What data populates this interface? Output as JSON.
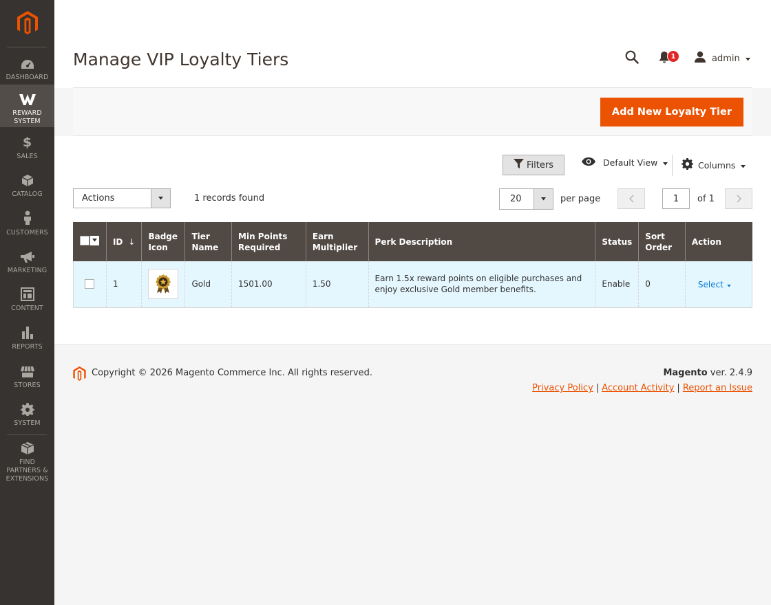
{
  "sidebar": {
    "items": [
      {
        "id": "dashboard",
        "label": "DASHBOARD",
        "icon": "dashboard-icon"
      },
      {
        "id": "reward",
        "label": "REWARD SYSTEM",
        "icon": "reward-w-icon"
      },
      {
        "id": "sales",
        "label": "SALES",
        "icon": "dollar-icon"
      },
      {
        "id": "catalog",
        "label": "CATALOG",
        "icon": "cube-icon"
      },
      {
        "id": "customers",
        "label": "CUSTOMERS",
        "icon": "person-icon"
      },
      {
        "id": "marketing",
        "label": "MARKETING",
        "icon": "megaphone-icon"
      },
      {
        "id": "content",
        "label": "CONTENT",
        "icon": "layout-icon"
      },
      {
        "id": "reports",
        "label": "REPORTS",
        "icon": "bar-chart-icon"
      },
      {
        "id": "stores",
        "label": "STORES",
        "icon": "storefront-icon"
      },
      {
        "id": "system",
        "label": "SYSTEM",
        "icon": "gear-icon"
      },
      {
        "id": "partners",
        "label": "FIND PARTNERS & EXTENSIONS",
        "icon": "box-icon"
      }
    ],
    "active": "reward"
  },
  "header": {
    "title": "Manage VIP Loyalty Tiers",
    "notifications_count": "1",
    "user_name": "admin"
  },
  "action_bar": {
    "add_button": "Add New Loyalty Tier"
  },
  "toolbar": {
    "filters_label": "Filters",
    "view_label": "Default View",
    "columns_label": "Columns",
    "actions_label": "Actions",
    "records_found": "1 records found",
    "per_page_value": "20",
    "per_page_label": "per page",
    "current_page": "1",
    "of_pages": "of 1"
  },
  "table": {
    "headers": {
      "id": "ID",
      "badge_icon_1": "Badge",
      "badge_icon_2": "Icon",
      "tier_name_1": "Tier",
      "tier_name_2": "Name",
      "min_points_1": "Min Points",
      "min_points_2": "Required",
      "earn_mult_1": "Earn",
      "earn_mult_2": "Multiplier",
      "perk": "Perk Description",
      "status": "Status",
      "sort_order_1": "Sort",
      "sort_order_2": "Order",
      "action": "Action"
    },
    "rows": [
      {
        "id": "1",
        "tier_name": "Gold",
        "min_points": "1501.00",
        "earn_multiplier": "1.50",
        "perk_description": "Earn 1.5x reward points on eligible purchases and enjoy exclusive Gold member benefits.",
        "status": "Enable",
        "sort_order": "0",
        "action": "Select"
      }
    ]
  },
  "footer": {
    "copyright": "Copyright © 2026 Magento Commerce Inc. All rights reserved.",
    "brand": "Magento",
    "version": " ver. 2.4.9",
    "links": [
      "Privacy Policy",
      "Account Activity",
      "Report an Issue"
    ]
  },
  "colors": {
    "accent": "#eb5202",
    "sidebar_bg": "#373330",
    "table_header_bg": "#514943",
    "row_highlight": "#e5f7fe",
    "link": "#007bdb"
  }
}
